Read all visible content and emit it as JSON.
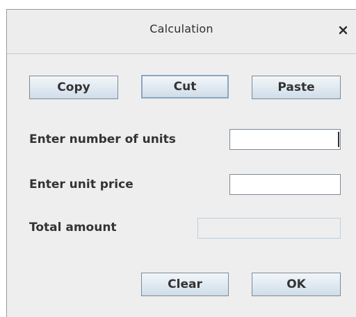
{
  "dialog": {
    "title": "Calculation",
    "close_icon": "close-icon"
  },
  "toolbar": {
    "copy_label": "Copy",
    "cut_label": "Cut",
    "paste_label": "Paste"
  },
  "form": {
    "units_label": "Enter number of units",
    "units_value": "",
    "price_label": "Enter unit price",
    "price_value": "",
    "total_label": "Total amount",
    "total_value": ""
  },
  "footer": {
    "clear_label": "Clear",
    "ok_label": "OK"
  }
}
